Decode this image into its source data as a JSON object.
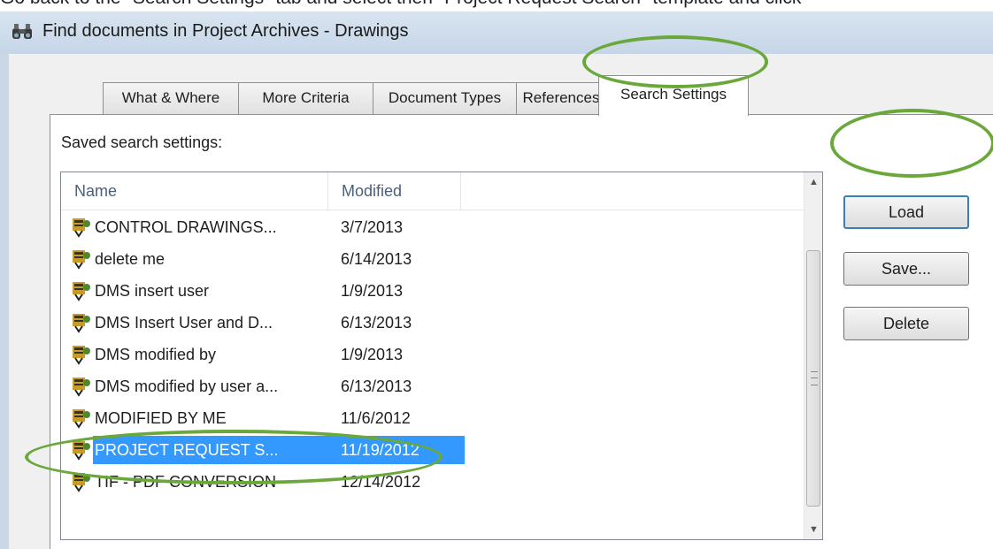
{
  "instruction": "Go back to the \"Search Settings\" tab and select then \"Project Request Search\" template and click",
  "window": {
    "title": "Find documents in Project Archives - Drawings"
  },
  "tabs": [
    {
      "label": "What & Where"
    },
    {
      "label": "More Criteria"
    },
    {
      "label": "Document Types"
    },
    {
      "label": "References"
    },
    {
      "label": "Search Settings"
    }
  ],
  "active_tab": "Search Settings",
  "saved_label": "Saved search settings:",
  "columns": {
    "name": "Name",
    "modified": "Modified"
  },
  "rows": [
    {
      "name": "CONTROL DRAWINGS...",
      "modified": "3/7/2013"
    },
    {
      "name": "delete me",
      "modified": "6/14/2013"
    },
    {
      "name": "DMS insert user",
      "modified": "1/9/2013"
    },
    {
      "name": "DMS Insert User and D...",
      "modified": "6/13/2013"
    },
    {
      "name": "DMS modified by",
      "modified": "1/9/2013"
    },
    {
      "name": "DMS modified by user a...",
      "modified": "6/13/2013"
    },
    {
      "name": "MODIFIED BY ME",
      "modified": "11/6/2012"
    },
    {
      "name": "PROJECT REQUEST S...",
      "modified": "11/19/2012",
      "selected": true
    },
    {
      "name": "TIF - PDF CONVERSION",
      "modified": "12/14/2012"
    }
  ],
  "buttons": {
    "load": "Load",
    "save": "Save...",
    "delete": "Delete"
  },
  "colors": {
    "selection": "#3399ff",
    "annotation": "#6aa83c"
  },
  "icons": {
    "title": "binoculars-icon",
    "row": "saved-search-icon"
  }
}
